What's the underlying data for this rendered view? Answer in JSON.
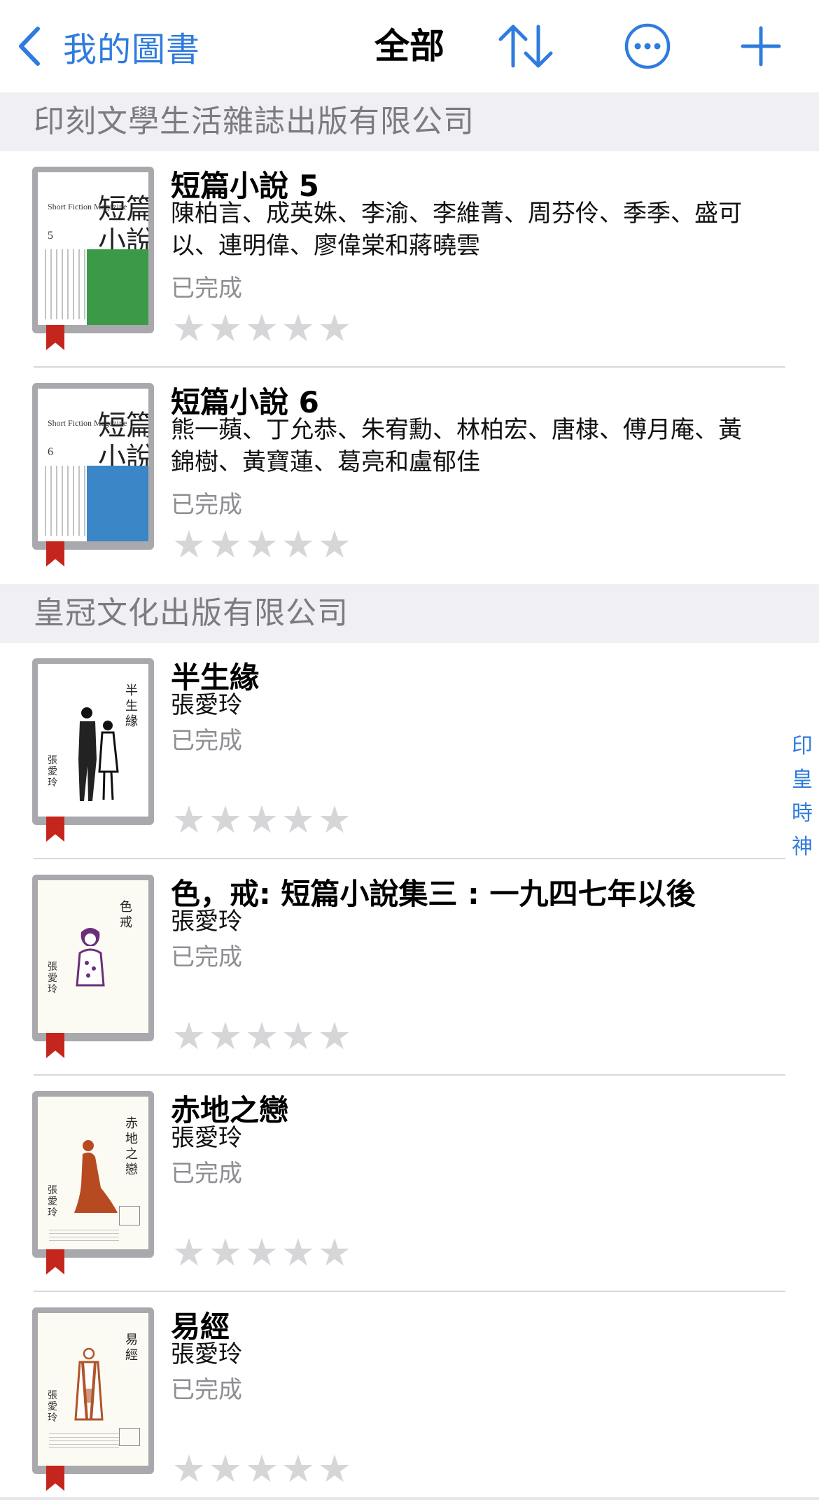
{
  "nav": {
    "back_label": "我的圖書",
    "title": "全部",
    "icons": [
      "chevron-left-icon",
      "sort-arrows-icon",
      "more-circle-icon",
      "plus-icon"
    ],
    "accent_color": "#2f7bde"
  },
  "sections": [
    {
      "header": "印刻文學生活雜誌出版有限公司",
      "books": [
        {
          "title": "短篇小說 5",
          "author": "陳柏言、成英姝、李渝、李維菁、周芬伶、季季、盛可以、連明偉、廖偉棠和蔣曉雲",
          "status": "已完成",
          "rating": 0,
          "cover": {
            "en": "Short Fiction Magazine",
            "num": "5",
            "zh": "短篇小說",
            "block_color": "#3b9a47"
          }
        },
        {
          "title": "短篇小說 6",
          "author": "熊一蘋、丁允恭、朱宥勳、林柏宏、唐棣、傅月庵、黃錦樹、黃寶蓮、葛亮和盧郁佳",
          "status": "已完成",
          "rating": 0,
          "cover": {
            "en": "Short Fiction Magazine",
            "num": "6",
            "zh": "短篇小說",
            "block_color": "#3a86c6"
          }
        }
      ]
    },
    {
      "header": "皇冠文化出版有限公司",
      "books": [
        {
          "title": "半生緣",
          "author": "張愛玲",
          "status": "已完成",
          "rating": 0,
          "cover": {
            "vtitle": "半生緣",
            "sign": "張愛玲"
          }
        },
        {
          "title": "色，戒: 短篇小說集三 : 一九四七年以後",
          "author": "張愛玲",
          "status": "已完成",
          "rating": 0,
          "cover": {
            "vtitle": "色戒",
            "sign": "張愛玲"
          }
        },
        {
          "title": "赤地之戀",
          "author": "張愛玲",
          "status": "已完成",
          "rating": 0,
          "cover": {
            "vtitle": "赤地之戀",
            "sign": "張愛玲"
          }
        },
        {
          "title": "易經",
          "author": "張愛玲",
          "status": "已完成",
          "rating": 0,
          "cover": {
            "vtitle": "易經",
            "sign": "張愛玲"
          }
        }
      ]
    }
  ],
  "index_bar": [
    "印",
    "皇",
    "時",
    "神"
  ],
  "star_glyph": "★"
}
